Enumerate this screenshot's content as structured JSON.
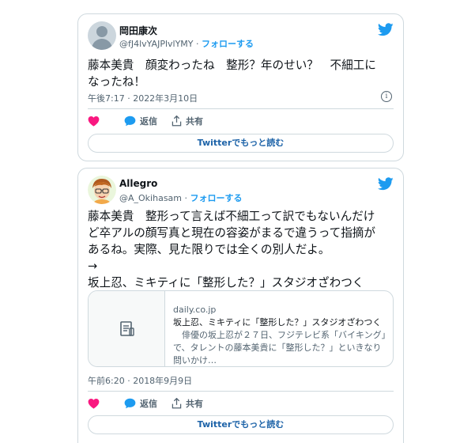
{
  "tweets": [
    {
      "name": "岡田康次",
      "handle": "@fJ4lvYAJPlvlYMY",
      "separator": " · ",
      "follow": "フォローする",
      "text": "藤本美貴　顔変わったね　整形？年のせい？　不細工に\nなったね！",
      "timestamp": "午後7:17 · 2022年3月10日",
      "like_icon": "heart-icon",
      "reply_label": "返信",
      "share_label": "共有",
      "more_label": "Twitterでもっと読む"
    },
    {
      "name": "Allegro",
      "handle": "@A_Okihasam",
      "separator": " · ",
      "follow": "フォローする",
      "text": "藤本美貴　整形って言えば不細工って訳でもないんだけ\nど卒アルの顔写真と現在の容姿がまるで違うって指摘が\nあるね。実際、見た限りでは全くの別人だよ。\n→\n坂上忍、ミキティに「整形した？」スタジオざわつく",
      "link_card": {
        "domain": "daily.co.jp",
        "title": "坂上忍、ミキティに「整形した？」スタジオざわつく",
        "description": "　俳優の坂上忍が２７日、フジテレビ系「バイキング」で、タレントの藤本美貴に「整形した？」といきなり問いかけ…"
      },
      "timestamp": "午前6:20 · 2018年9月9日",
      "reply_label": "返信",
      "share_label": "共有",
      "more_label": "Twitterでもっと読む"
    }
  ],
  "colors": {
    "accent": "#1d9bf0",
    "like": "#f91880",
    "text": "#0f1419",
    "muted": "#536471",
    "border": "#cfd9de"
  },
  "icons": [
    "twitter-bird-icon",
    "heart-icon",
    "reply-bubble-icon",
    "share-icon",
    "info-icon",
    "document-icon"
  ]
}
